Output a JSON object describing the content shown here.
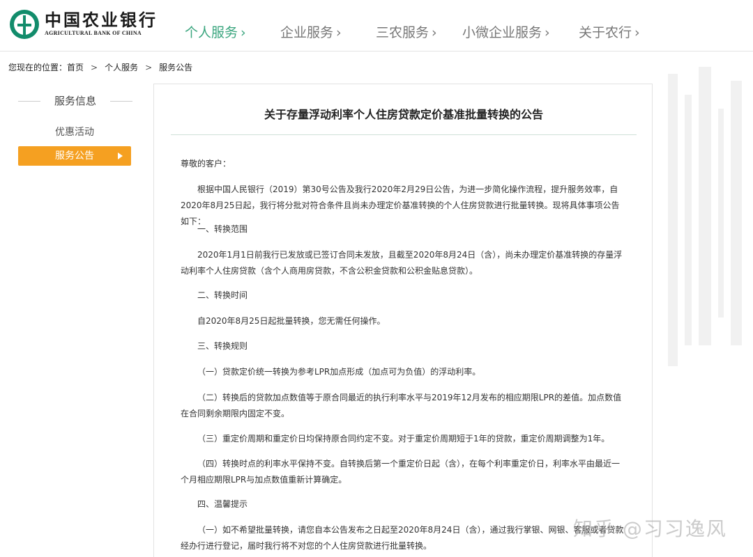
{
  "brand": {
    "name_cn": "中国农业银行",
    "name_en": "AGRICULTURAL BANK OF CHINA",
    "logo_icon": "abc-bank-logo",
    "accent_color": "#3aa57e"
  },
  "nav": {
    "items": [
      {
        "label": "个人服务",
        "chevron": "›",
        "active": true
      },
      {
        "label": "企业服务",
        "chevron": "›",
        "active": false
      },
      {
        "label": "三农服务",
        "chevron": "›",
        "active": false
      },
      {
        "label": "小微企业服务",
        "chevron": "›",
        "active": false
      },
      {
        "label": "关于农行",
        "chevron": "›",
        "active": false
      }
    ]
  },
  "breadcrumb": {
    "prefix": "您现在的位置：",
    "items": [
      "首页",
      "个人服务",
      "服务公告"
    ],
    "separator": ">"
  },
  "sidebar": {
    "title": "服务信息",
    "items": [
      {
        "label": "优惠活动",
        "active": false
      },
      {
        "label": "服务公告",
        "active": true
      }
    ],
    "active_color": "#f5a021"
  },
  "article": {
    "title": "关于存量浮动利率个人住房贷款定价基准批量转换的公告",
    "paragraphs": [
      {
        "text": "尊敬的客户：",
        "indent": false
      },
      {
        "text": "根据中国人民银行（2019）第30号公告及我行2020年2月29日公告，为进一步简化操作流程，提升服务效率，自2020年8月25日起，我行将分批对符合条件且尚未办理定价基准转换的个人住房贷款进行批量转换。现将具体事项公告如下：",
        "indent": true
      },
      {
        "text": "一、转换范围",
        "indent": true
      },
      {
        "text": "2020年1月1日前我行已发放或已签订合同未发放，且截至2020年8月24日（含），尚未办理定价基准转换的存量浮动利率个人住房贷款（含个人商用房贷款，不含公积金贷款和公积金贴息贷款）。",
        "indent": true
      },
      {
        "text": "二、转换时间",
        "indent": true
      },
      {
        "text": "自2020年8月25日起批量转换，您无需任何操作。",
        "indent": true
      },
      {
        "text": "三、转换规则",
        "indent": true
      },
      {
        "text": "（一）贷款定价统一转换为参考LPR加点形成（加点可为负值）的浮动利率。",
        "indent": true
      },
      {
        "text": "（二）转换后的贷款加点数值等于原合同最近的执行利率水平与2019年12月发布的相应期限LPR的差值。加点数值在合同剩余期限内固定不变。",
        "indent": true
      },
      {
        "text": "（三）重定价周期和重定价日均保持原合同约定不变。对于重定价周期短于1年的贷款，重定价周期调整为1年。",
        "indent": true
      },
      {
        "text": "（四）转换时点的利率水平保持不变。自转换后第一个重定价日起（含），在每个利率重定价日，利率水平由最近一个月相应期限LPR与加点数值重新计算确定。",
        "indent": true
      },
      {
        "text": "四、温馨提示",
        "indent": true
      },
      {
        "text": "（一）如不希望批量转换，请您自本公告发布之日起至2020年8月24日（含），通过我行掌银、网银、客服或者贷款经办行进行登记，届时我行将不对您的个人住房贷款进行批量转换。",
        "indent": true
      }
    ]
  },
  "watermark": "知乎 @习习逸风"
}
